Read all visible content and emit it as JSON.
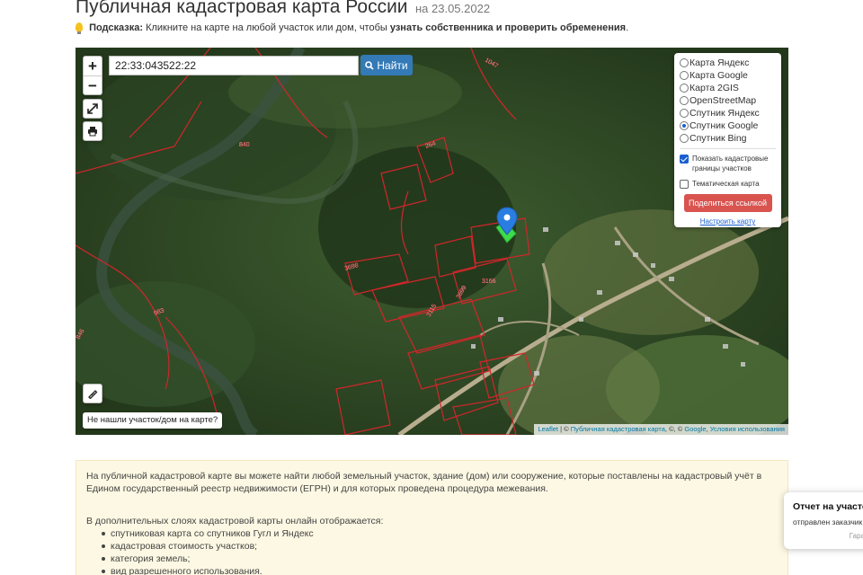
{
  "header": {
    "title": "Публичная кадастровая карта России",
    "date": "на 23.05.2022"
  },
  "hint": {
    "label": "Подсказка:",
    "text": "Кликните на карте на любой участок или дом, чтобы",
    "bold": "узнать собственника и проверить обременения",
    "end": "."
  },
  "map": {
    "zoom_in": "+",
    "zoom_out": "−",
    "search": {
      "value": "22:33:043522:22",
      "button": "Найти"
    },
    "layers": [
      {
        "label": "Карта Яндекс",
        "selected": false
      },
      {
        "label": "Карта Google",
        "selected": false
      },
      {
        "label": "Карта 2GIS",
        "selected": false
      },
      {
        "label": "OpenStreetMap",
        "selected": false
      },
      {
        "label": "Спутник Яндекс",
        "selected": false
      },
      {
        "label": "Спутник Google",
        "selected": true
      },
      {
        "label": "Спутник Bing",
        "selected": false
      }
    ],
    "show_borders": {
      "label": "Показать кадастровые границы участков",
      "checked": true
    },
    "thematic": {
      "label": "Тематическая карта",
      "checked": false
    },
    "share_button": "Поделиться ссылкой",
    "setup_link": "Настроить карту",
    "not_found": "Не нашли участок/дом на карте?",
    "attribution": {
      "leaflet": "Leaflet",
      "sep1": " | © ",
      "pkk": "Публичная кадастровая карта",
      "sep2": ", ©, © ",
      "google": "Google",
      "sep3": ", ",
      "terms": "Условия использования"
    },
    "parcel_labels": [
      "1047",
      "840",
      "264",
      "3698",
      "3166",
      "3699",
      "983",
      "846",
      "3115"
    ]
  },
  "info": {
    "p1": "На публичной кадастровой карте вы можете найти любой земельный участок, здание (дом) или сооружение, которые поставлены на кадастровый учёт в Едином государственный реестр недвижимости (ЕГРН) и для которых проведена процедура межевания.",
    "p2": "В дополнительных слоях кадастровой карты онлайн отображается:",
    "items": [
      "спутниковая карта со спутников Гугл и Яндекс",
      "кадастровая стоимость участков;",
      "категория земель;",
      "вид разрешенного использования."
    ]
  },
  "toast": {
    "title": "Отчет на участо",
    "body": "отправлен заказчик",
    "footer": "Гара"
  },
  "colors": {
    "primary": "#337ab7",
    "danger": "#d9534f",
    "parcel_border": "#d0262b",
    "info_bg": "#fcf8e3",
    "marker": "#2a7de1",
    "selected_parcel": "#3ddc4a"
  }
}
